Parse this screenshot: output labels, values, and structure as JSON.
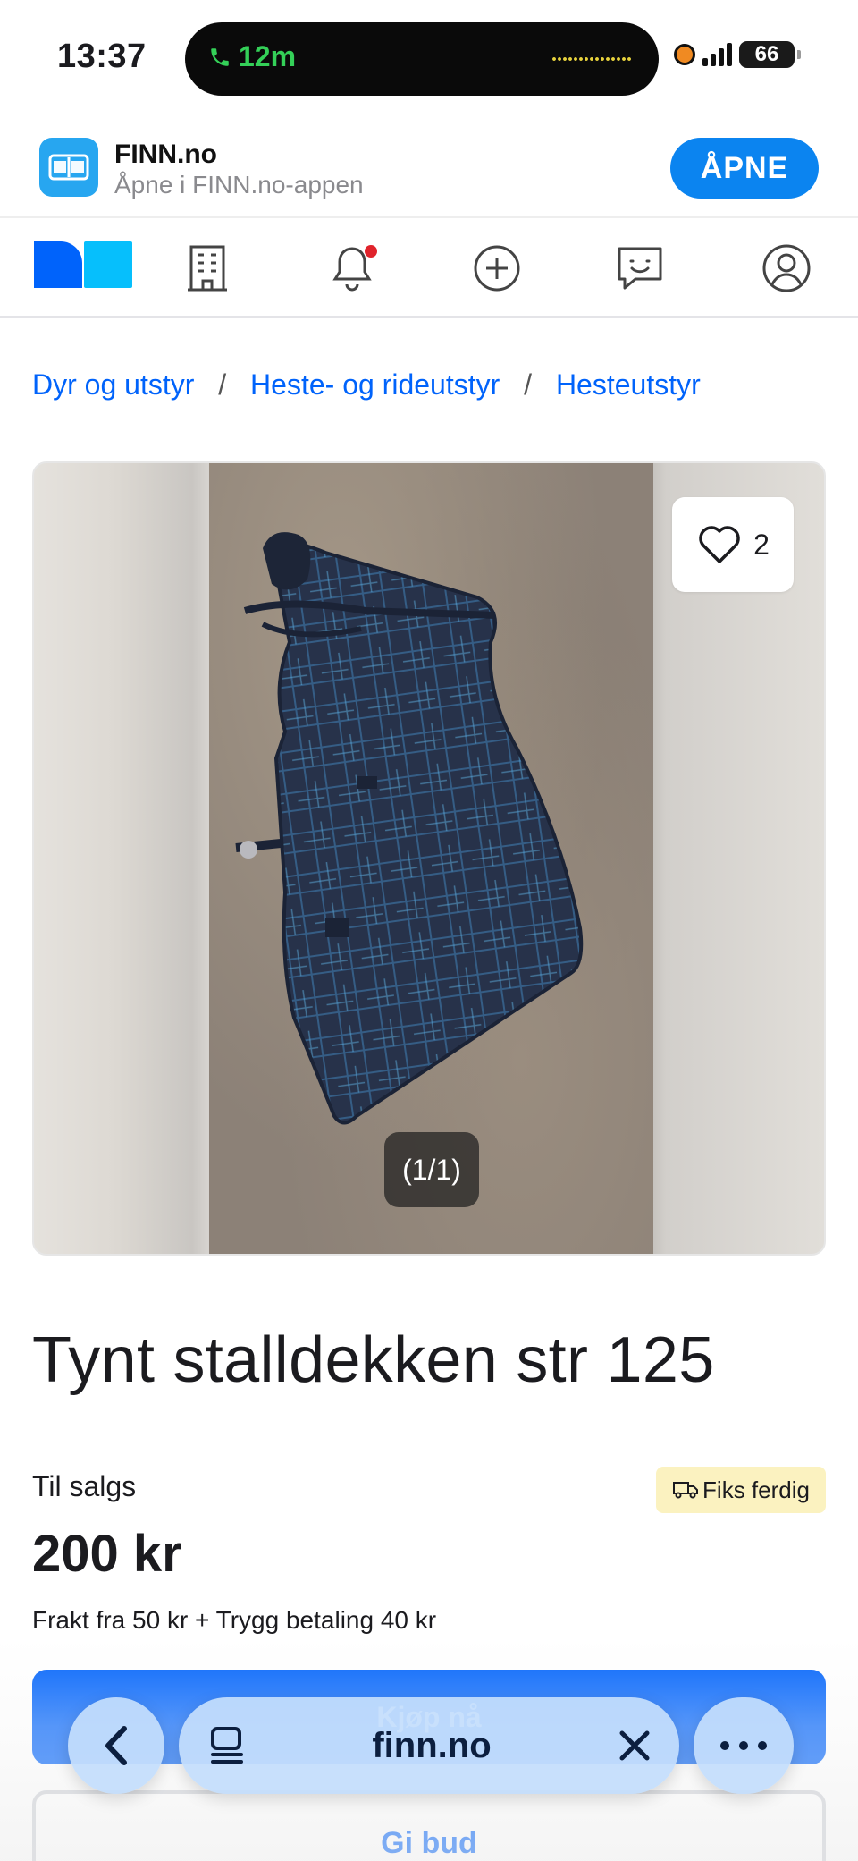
{
  "status_bar": {
    "time": "13:37",
    "call_duration": "12m",
    "battery": "66"
  },
  "app_banner": {
    "app_name": "FINN.no",
    "subtitle": "Åpne i FINN.no-appen",
    "open_label": "ÅPNE"
  },
  "nav": {
    "icons": [
      "finn-logo",
      "building-icon",
      "bell-icon",
      "plus-circle-icon",
      "chat-icon",
      "profile-icon"
    ]
  },
  "breadcrumb": {
    "items": [
      "Dyr og utstyr",
      "Heste- og rideutstyr",
      "Hesteutstyr"
    ],
    "separator": "/"
  },
  "gallery": {
    "favorite_count": "2",
    "counter": "(1/1)"
  },
  "listing": {
    "title": "Tynt stalldekken str 125",
    "sale_label": "Til salgs",
    "badge": "Fiks ferdig",
    "price": "200 kr",
    "shipping": "Frakt fra 50 kr + Trygg betaling 40 kr"
  },
  "actions": {
    "buy_label": "Kjøp nå",
    "bid_label": "Gi bud"
  },
  "browser": {
    "url": "finn.no"
  },
  "colors": {
    "brand_blue": "#0063fb",
    "banner_button": "#0b84f0",
    "badge_bg": "#fbf2c0",
    "notification": "#e0232b"
  }
}
